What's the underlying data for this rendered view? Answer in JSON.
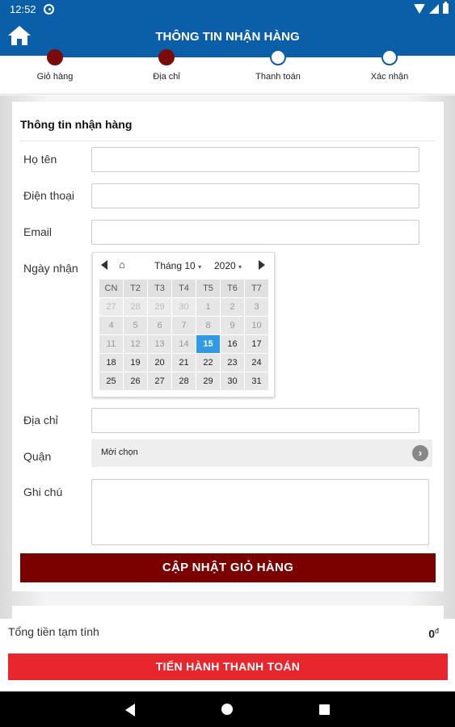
{
  "status_bar": {
    "time": "12:52"
  },
  "header": {
    "title": "THÔNG TIN NHẬN HÀNG"
  },
  "steps": [
    {
      "label": "Giỏ hàng",
      "state": "done"
    },
    {
      "label": "Địa chỉ",
      "state": "done"
    },
    {
      "label": "Thanh toán",
      "state": "pending"
    },
    {
      "label": "Xác nhận",
      "state": "pending"
    }
  ],
  "form": {
    "title": "Thông tin nhận hàng",
    "name_label": "Họ tên",
    "phone_label": "Điện thoại",
    "email_label": "Email",
    "date_label": "Ngày nhận",
    "address_label": "Địa chỉ",
    "district_label": "Quận",
    "district_value": "Mời chọn",
    "note_label": "Ghi chú",
    "update_button": "CẬP NHẬT GIỎ HÀNG"
  },
  "calendar": {
    "month": "Tháng 10",
    "year": "2020",
    "weekdays": [
      "CN",
      "T2",
      "T3",
      "T4",
      "T5",
      "T6",
      "T7"
    ],
    "weeks": [
      [
        "27",
        "28",
        "29",
        "30",
        "1",
        "2",
        "3"
      ],
      [
        "4",
        "5",
        "6",
        "7",
        "8",
        "9",
        "10"
      ],
      [
        "11",
        "12",
        "13",
        "14",
        "15",
        "16",
        "17"
      ],
      [
        "18",
        "19",
        "20",
        "21",
        "22",
        "23",
        "24"
      ],
      [
        "25",
        "26",
        "27",
        "28",
        "29",
        "30",
        "31"
      ]
    ],
    "selected_day": "15"
  },
  "summary": {
    "total_label": "Tổng tiền tạm tính",
    "total_value": "0",
    "currency": "đ",
    "checkout_button": "TIẾN HÀNH THANH TOÁN"
  },
  "colors": {
    "primary": "#0b5ea8",
    "accent_dark_red": "#7b0000",
    "checkout_red": "#e8262d",
    "selected_blue": "#2f9be6"
  }
}
